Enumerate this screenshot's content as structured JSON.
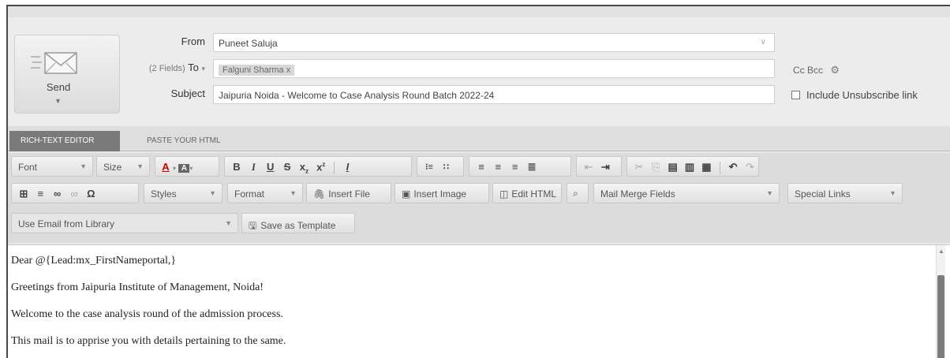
{
  "compose": {
    "send_label": "Send",
    "from_label": "From",
    "from_value": "Puneet Saluja",
    "to_fields_label": "(2 Fields)",
    "to_label": "To",
    "to_recipient": "Falguni Sharma",
    "to_remove": "x",
    "subject_label": "Subject",
    "subject_value": "Jaipuria Noida - Welcome to Case Analysis Round Batch 2022-24",
    "cc_bcc": "Cc Bcc",
    "unsubscribe_label": "Include Unsubscribe link"
  },
  "tabs": {
    "rich_text": "RICH-TEXT EDITOR",
    "paste_html": "PASTE YOUR HTML"
  },
  "toolbar": {
    "font": "Font",
    "size": "Size",
    "styles": "Styles",
    "format": "Format",
    "insert_file": "Insert File",
    "insert_image": "Insert Image",
    "edit_html": "Edit HTML",
    "mail_merge": "Mail Merge Fields",
    "special_links": "Special Links",
    "use_email_library": "Use Email from Library",
    "save_template": "Save as Template"
  },
  "body": {
    "line1": "Dear @{Lead:mx_FirstNameportal,}",
    "line2": "Greetings from Jaipuria Institute of Management, Noida!",
    "line3": "Welcome to the case analysis round of the admission process.",
    "line4": "This mail is to apprise you with details pertaining to the same."
  },
  "icons": [
    "send-envelope-icon",
    "settings-gear-icon",
    "text-color-icon",
    "bg-color-icon",
    "bold-icon",
    "italic-icon",
    "underline-icon",
    "strike-icon",
    "subscript-icon",
    "superscript-icon",
    "remove-format-icon",
    "ordered-list-icon",
    "bullet-list-icon",
    "align-left-icon",
    "align-center-icon",
    "align-right-icon",
    "justify-icon",
    "outdent-icon",
    "indent-icon",
    "cut-icon",
    "copy-icon",
    "paste-icon",
    "paste-text-icon",
    "paste-word-icon",
    "undo-icon",
    "redo-icon",
    "table-icon",
    "hr-icon",
    "link-icon",
    "unlink-icon",
    "special-char-icon",
    "paperclip-icon",
    "image-icon",
    "html-icon",
    "preview-icon",
    "save-icon"
  ]
}
